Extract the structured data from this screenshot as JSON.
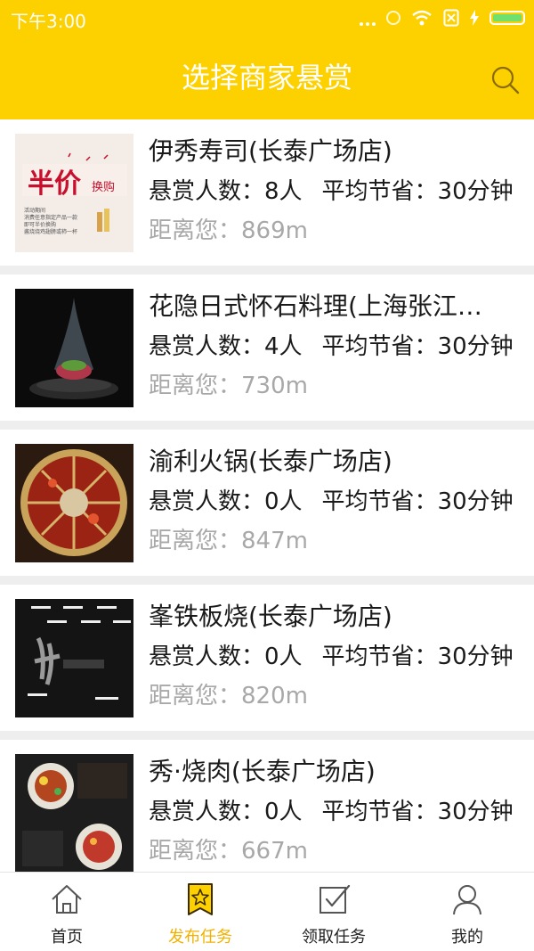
{
  "status_bar": {
    "time": "下午3:00"
  },
  "header": {
    "title": "选择商家悬赏"
  },
  "merchants": [
    {
      "name": "伊秀寿司(长泰广场店)",
      "reward_count": "悬赏人数：8人",
      "avg_saving": "平均节省：30分钟",
      "distance": "距离您：869m",
      "poster": {
        "headline": "半价",
        "sub": "换购",
        "lines": [
          "活动期间",
          "消费任意指定产品一款",
          "即可半价换购",
          "酱烧烧鸡翅膀或柿一杯"
        ]
      }
    },
    {
      "name": "花隐日式怀石料理(上海张江…",
      "reward_count": "悬赏人数：4人",
      "avg_saving": "平均节省：30分钟",
      "distance": "距离您：730m"
    },
    {
      "name": "渝利火锅(长泰广场店)",
      "reward_count": "悬赏人数：0人",
      "avg_saving": "平均节省：30分钟",
      "distance": "距离您：847m"
    },
    {
      "name": "峯铁板烧(长泰广场店)",
      "reward_count": "悬赏人数：0人",
      "avg_saving": "平均节省：30分钟",
      "distance": "距离您：820m"
    },
    {
      "name": "秀·烧肉(长泰广场店)",
      "reward_count": "悬赏人数：0人",
      "avg_saving": "平均节省：30分钟",
      "distance": "距离您：667m"
    }
  ],
  "tabbar": {
    "items": [
      {
        "label": "首页",
        "icon": "home-icon",
        "active": false
      },
      {
        "label": "发布任务",
        "icon": "bookmark-star-icon",
        "active": true
      },
      {
        "label": "领取任务",
        "icon": "checkbox-icon",
        "active": false
      },
      {
        "label": "我的",
        "icon": "user-icon",
        "active": false
      }
    ]
  },
  "colors": {
    "brand_yellow": "#fdd100",
    "active_tab": "#f2b100",
    "muted_text": "#a8a8a8"
  }
}
